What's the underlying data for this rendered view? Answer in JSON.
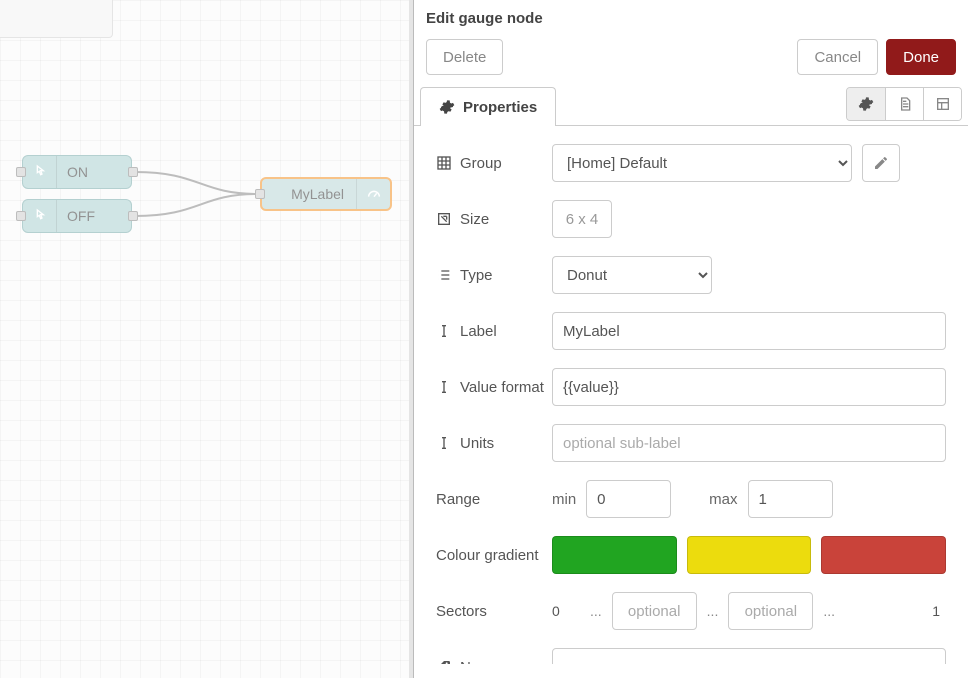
{
  "canvas": {
    "nodes": {
      "on": {
        "label": "ON"
      },
      "off": {
        "label": "OFF"
      },
      "gauge": {
        "label": "MyLabel"
      }
    }
  },
  "panel": {
    "title": "Edit gauge node",
    "actions": {
      "delete": "Delete",
      "cancel": "Cancel",
      "done": "Done"
    },
    "tabs": {
      "properties": "Properties"
    }
  },
  "form": {
    "group": {
      "label": "Group",
      "value": "[Home] Default"
    },
    "size": {
      "label": "Size",
      "value": "6 x 4"
    },
    "type": {
      "label": "Type",
      "value": "Donut"
    },
    "labelField": {
      "label": "Label",
      "value": "MyLabel"
    },
    "valueFormat": {
      "label": "Value format",
      "value": "{{value}}"
    },
    "units": {
      "label": "Units",
      "placeholder": "optional sub-label",
      "value": ""
    },
    "range": {
      "label": "Range",
      "minLabel": "min",
      "min": "0",
      "maxLabel": "max",
      "max": "1"
    },
    "gradient": {
      "label": "Colour gradient",
      "colors": [
        "#21a521",
        "#ecdc0d",
        "#c9433a"
      ]
    },
    "sectors": {
      "label": "Sectors",
      "start": "0",
      "end": "1",
      "optional": "optional",
      "dots": "..."
    },
    "name": {
      "label": "Name",
      "value": ""
    }
  }
}
